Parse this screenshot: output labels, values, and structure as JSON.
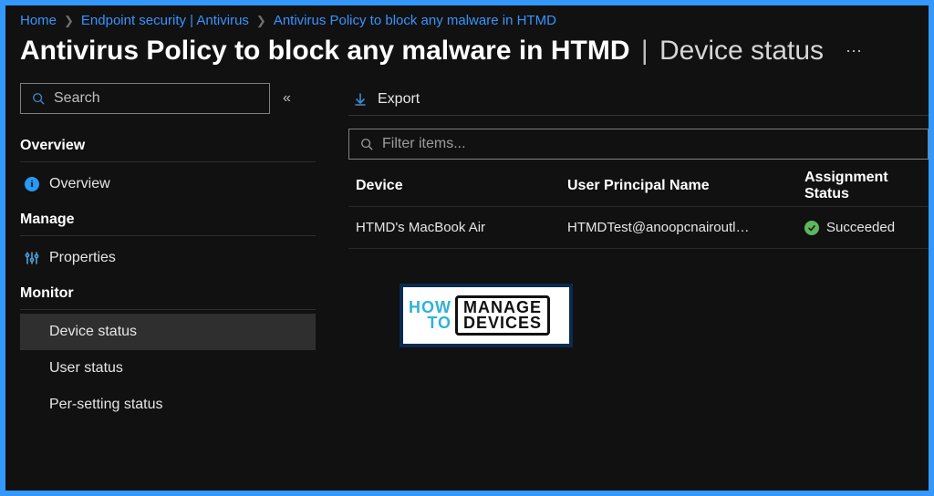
{
  "breadcrumbs": {
    "b0": "Home",
    "b1": "Endpoint security | Antivirus",
    "b2": "Antivirus Policy to block any malware in HTMD"
  },
  "title": {
    "main": "Antivirus Policy to block any malware in HTMD",
    "sub": "Device status"
  },
  "sidebar": {
    "search_placeholder": "Search",
    "sections": {
      "overview_header": "Overview",
      "manage_header": "Manage",
      "monitor_header": "Monitor"
    },
    "overview_label": "Overview",
    "properties_label": "Properties",
    "device_status_label": "Device status",
    "user_status_label": "User status",
    "per_setting_status_label": "Per-setting status"
  },
  "toolbar": {
    "export_label": "Export"
  },
  "filter_placeholder": "Filter items...",
  "columns": {
    "device": "Device",
    "upn": "User Principal Name",
    "status": "Assignment Status"
  },
  "rows": [
    {
      "device": "HTMD's MacBook Air",
      "upn": "HTMDTest@anoopcnairoutl…",
      "status": "Succeeded"
    }
  ],
  "watermark": {
    "how": "HOW",
    "to": "TO",
    "manage": "MANAGE",
    "devices": "DEVICES"
  }
}
